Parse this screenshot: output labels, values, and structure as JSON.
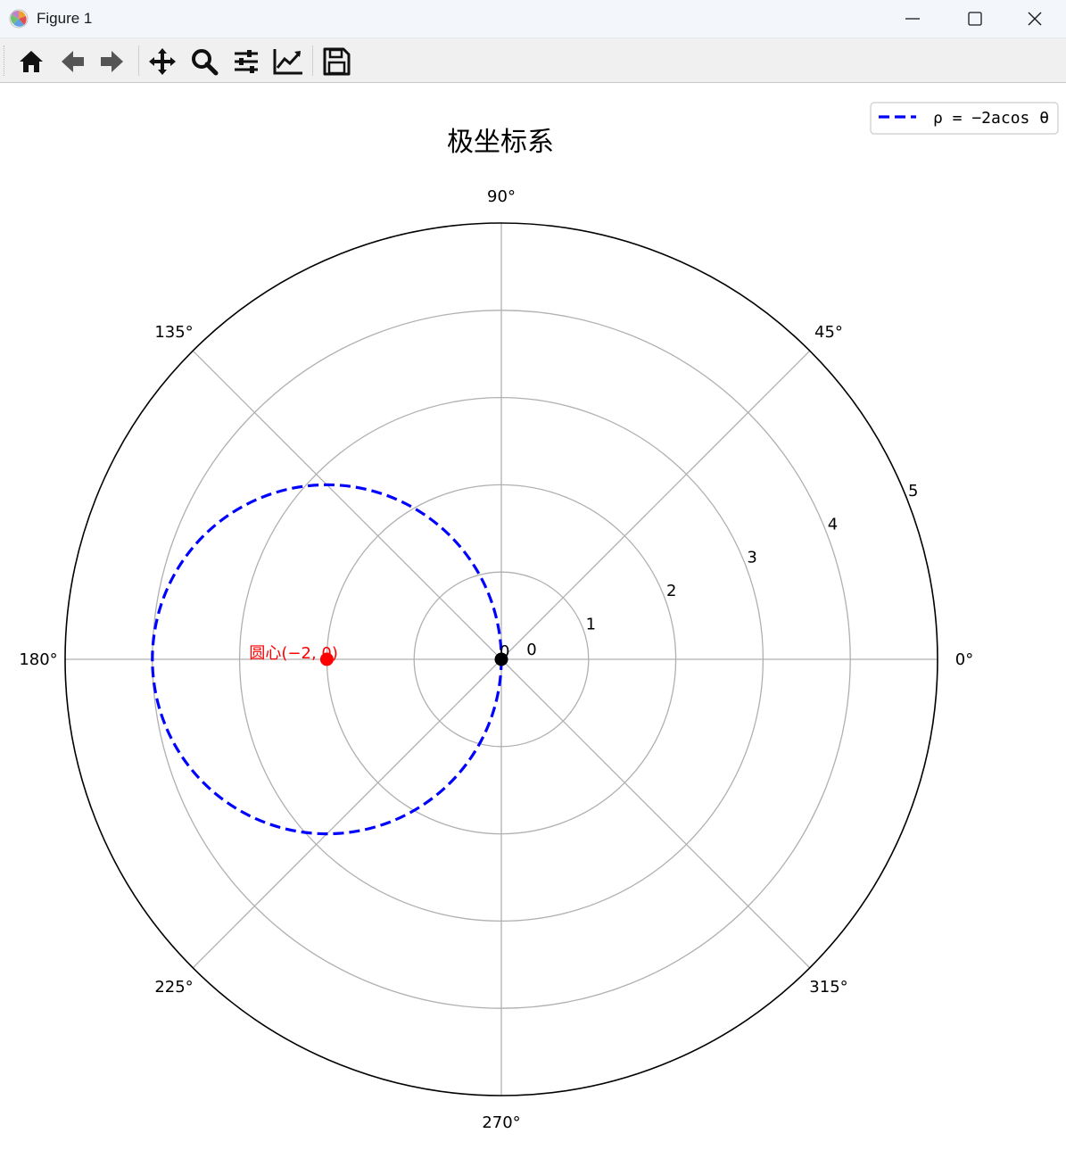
{
  "window": {
    "title": "Figure 1",
    "app_icon": "matplotlib-logo-icon",
    "controls": [
      "minimize-icon",
      "maximize-icon",
      "close-icon"
    ]
  },
  "toolbar": {
    "buttons": [
      {
        "name": "home-button",
        "icon": "home-icon"
      },
      {
        "name": "back-button",
        "icon": "arrow-left-icon"
      },
      {
        "name": "forward-button",
        "icon": "arrow-right-icon"
      },
      {
        "name": "pan-button",
        "icon": "move-arrows-icon"
      },
      {
        "name": "zoom-button",
        "icon": "magnifier-icon"
      },
      {
        "name": "subplots-button",
        "icon": "sliders-icon"
      },
      {
        "name": "axes-edit-button",
        "icon": "line-chart-icon"
      },
      {
        "name": "save-button",
        "icon": "floppy-disk-icon"
      }
    ]
  },
  "chart_data": {
    "type": "line",
    "projection": "polar",
    "title": "极坐标系",
    "theta_ticks": [
      "0°",
      "45°",
      "90°",
      "135°",
      "180°",
      "225°",
      "270°",
      "315°"
    ],
    "theta_tick_values_deg": [
      0,
      45,
      90,
      135,
      180,
      225,
      270,
      315
    ],
    "r_ticks": [
      "0",
      "1",
      "2",
      "3",
      "4",
      "5"
    ],
    "r_tick_values": [
      0,
      1,
      2,
      3,
      4,
      5
    ],
    "rlim": [
      0,
      5
    ],
    "grid": true,
    "legend": {
      "placement": "top-right",
      "entries": [
        "ρ  = −2acos θ"
      ]
    },
    "series": [
      {
        "name": "ρ  = −2acos θ",
        "style": "dashed",
        "color": "#0000ff",
        "equation": "x^2 + y^2 = -4x",
        "a": 2,
        "center_xy": [
          -2,
          0
        ],
        "radius": 2
      }
    ],
    "points": [
      {
        "label": "圆心(−2, 0)",
        "r": 2,
        "theta_deg": 180,
        "color": "#ff0000"
      },
      {
        "label": "0",
        "r": 0,
        "theta_deg": 0,
        "color": "#000000"
      }
    ]
  }
}
